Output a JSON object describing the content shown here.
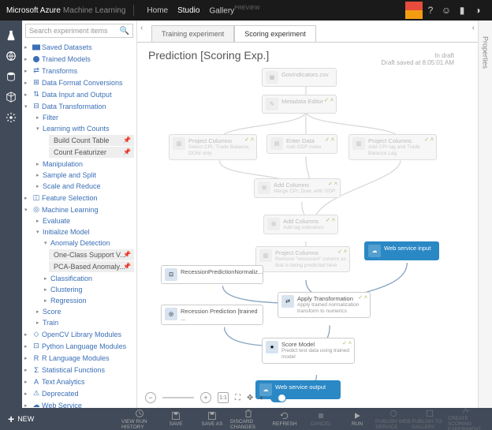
{
  "top": {
    "brand": "Microsoft Azure",
    "brand2": "Machine Learning",
    "home": "Home",
    "studio": "Studio",
    "gallery": "Gallery",
    "preview": "PREVIEW"
  },
  "search": {
    "placeholder": "Search experiment items"
  },
  "nav": {
    "items": [
      {
        "label": "Saved Datasets"
      },
      {
        "label": "Trained Models"
      },
      {
        "label": "Transforms"
      },
      {
        "label": "Data Format Conversions"
      },
      {
        "label": "Data Input and Output"
      }
    ],
    "dt": {
      "label": "Data Transformation",
      "filter": "Filter",
      "lwc": "Learning with Counts",
      "bct": "Build Count Table",
      "cf": "Count Featurizer",
      "man": "Manipulation",
      "sas": "Sample and Split",
      "sar": "Scale and Reduce"
    },
    "fs": "Feature Selection",
    "ml": {
      "label": "Machine Learning",
      "ev": "Evaluate",
      "im": "Initialize Model",
      "ad": "Anomaly Detection",
      "ocs": "One-Class Support V...",
      "pca": "PCA-Based Anomaly...",
      "cl": "Classification",
      "clu": "Clustering",
      "reg": "Regression",
      "sc": "Score",
      "tr": "Train"
    },
    "rest": [
      "OpenCV Library Modules",
      "Python Language Modules",
      "R Language Modules",
      "Statistical Functions",
      "Text Analytics",
      "Deprecated",
      "Web Service"
    ]
  },
  "tabs": {
    "train": "Training experiment",
    "score": "Scoring experiment"
  },
  "title": "Prediction [Scoring Exp.]",
  "status": {
    "draft": "In draft",
    "saved": "Draft saved at 8:05:01 AM"
  },
  "nodes": {
    "d1": "GovIndicators.csv",
    "d2": "Metadata Editor",
    "p1": {
      "n": "Project Columns",
      "d": "Select CPI, Trade Balance, DOW only"
    },
    "p2": {
      "n": "Enter Data",
      "d": "Add GDP index"
    },
    "p3": {
      "n": "Project Columns",
      "d": "Add CPI lag and Trade Balance Lag"
    },
    "a1": {
      "n": "Add Columns",
      "d": "Merge CPI, Dow, with GDP"
    },
    "a2": {
      "n": "Add Columns",
      "d": "Add lag indicators"
    },
    "r1": {
      "n": "Project Columns",
      "d": "Remove \"recession\" column as that is being predicted here"
    },
    "ws1": "Web service input",
    "t1": "RecessionPredictionNormaliz...",
    "t2": "Recession Prediction [trained ...",
    "ap": {
      "n": "Apply Transformation",
      "d": "Apply trained normalization transform to numerics"
    },
    "sm": {
      "n": "Score Model",
      "d": "Predict test data using trained model"
    },
    "ws2": "Web service output"
  },
  "rside": "Properties",
  "foot": {
    "new": "NEW",
    "b": [
      "VIEW RUN HISTORY",
      "SAVE",
      "SAVE AS",
      "DISCARD CHANGES",
      "REFRESH",
      "CANCEL",
      "RUN",
      "PUBLISH WEB SERVICE",
      "PUBLISH TO GALLERY",
      "CREATE SCORING EXPERIMENT"
    ]
  }
}
